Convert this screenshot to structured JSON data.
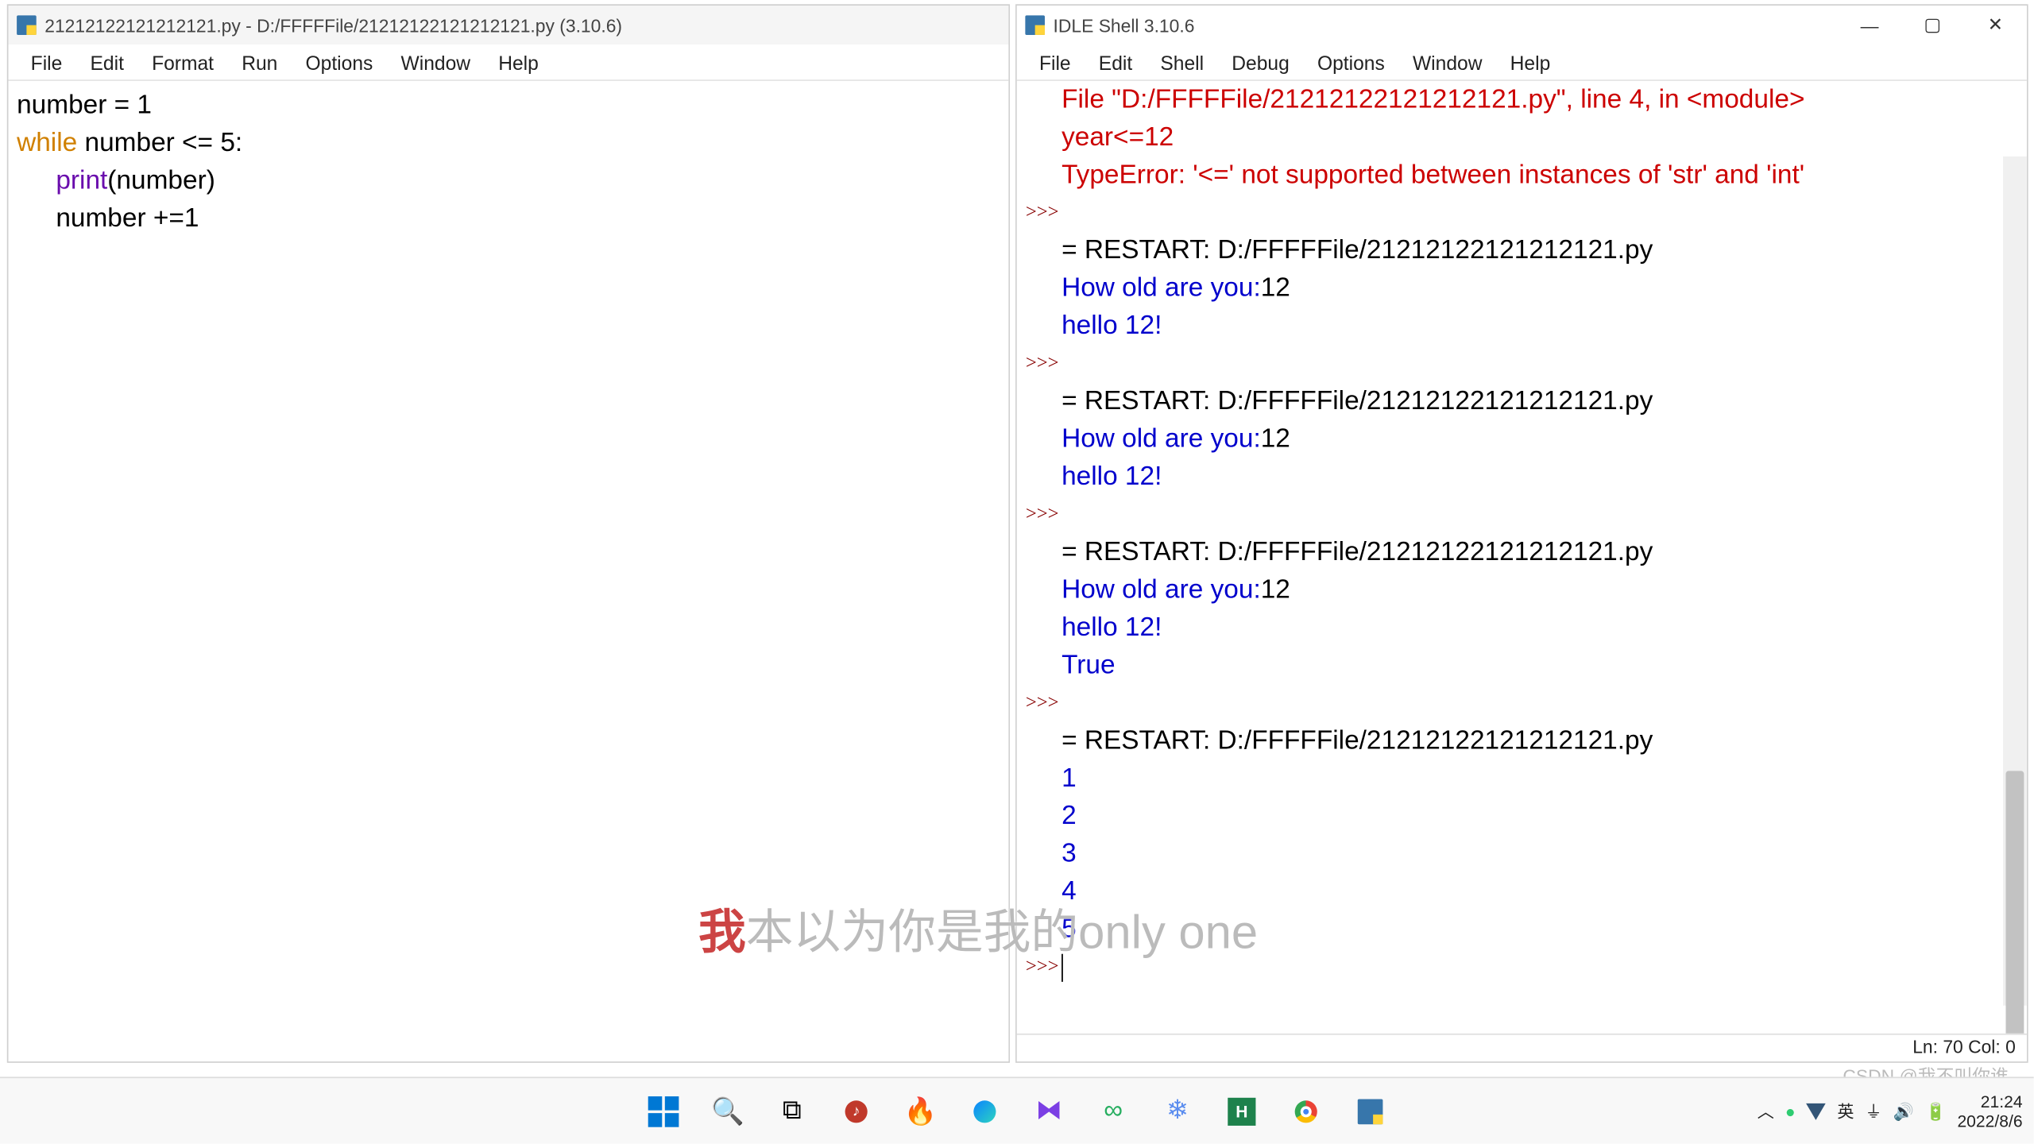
{
  "editor": {
    "title": "21212122121212121.py - D:/FFFFFile/21212122121212121.py (3.10.6)",
    "menu": [
      "File",
      "Edit",
      "Format",
      "Run",
      "Options",
      "Window",
      "Help"
    ],
    "code": {
      "l1a": "number = 1",
      "l2kw": "while",
      "l2rest": " number <= 5:",
      "l3fn": "print",
      "l3rest": "(number)",
      "l4": "number +=1"
    }
  },
  "shell": {
    "title": "IDLE Shell 3.10.6",
    "menu": [
      "File",
      "Edit",
      "Shell",
      "Debug",
      "Options",
      "Window",
      "Help"
    ],
    "prompt": ">>>",
    "err1": "  File \"D:/FFFFFile/21212122121212121.py\", line 4, in <module>",
    "err2": "    year<=12",
    "err3": "TypeError: '<=' not supported between instances of 'str' and 'int'",
    "restart": "= RESTART: D:/FFFFFile/21212122121212121.py",
    "how_prompt": "How old are you:",
    "how_in": "12",
    "hello": "hello 12!",
    "true": "True",
    "nums": [
      "1",
      "2",
      "3",
      "4",
      "5"
    ],
    "status": "Ln: 70  Col: 0"
  },
  "watermark": {
    "red": "我",
    "rest": "本以为你是我的only one"
  },
  "csdn": "CSDN @我不叫你谁",
  "tray": {
    "ime": "英",
    "time": "21:24",
    "date": "2022/8/6"
  }
}
